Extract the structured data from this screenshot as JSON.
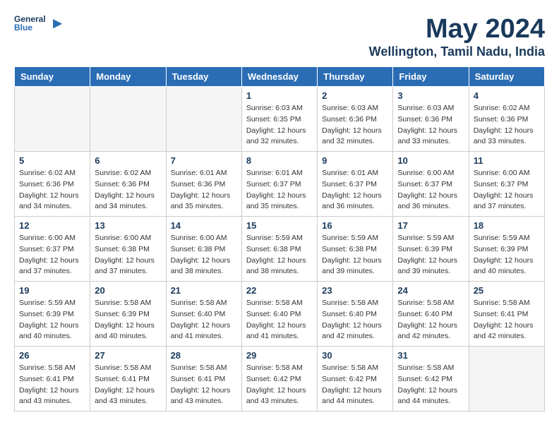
{
  "header": {
    "logo_general": "General",
    "logo_blue": "Blue",
    "main_title": "May 2024",
    "subtitle": "Wellington, Tamil Nadu, India"
  },
  "calendar": {
    "days_of_week": [
      "Sunday",
      "Monday",
      "Tuesday",
      "Wednesday",
      "Thursday",
      "Friday",
      "Saturday"
    ],
    "weeks": [
      [
        {
          "day": "",
          "info": ""
        },
        {
          "day": "",
          "info": ""
        },
        {
          "day": "",
          "info": ""
        },
        {
          "day": "1",
          "info": "Sunrise: 6:03 AM\nSunset: 6:35 PM\nDaylight: 12 hours\nand 32 minutes."
        },
        {
          "day": "2",
          "info": "Sunrise: 6:03 AM\nSunset: 6:36 PM\nDaylight: 12 hours\nand 32 minutes."
        },
        {
          "day": "3",
          "info": "Sunrise: 6:03 AM\nSunset: 6:36 PM\nDaylight: 12 hours\nand 33 minutes."
        },
        {
          "day": "4",
          "info": "Sunrise: 6:02 AM\nSunset: 6:36 PM\nDaylight: 12 hours\nand 33 minutes."
        }
      ],
      [
        {
          "day": "5",
          "info": "Sunrise: 6:02 AM\nSunset: 6:36 PM\nDaylight: 12 hours\nand 34 minutes."
        },
        {
          "day": "6",
          "info": "Sunrise: 6:02 AM\nSunset: 6:36 PM\nDaylight: 12 hours\nand 34 minutes."
        },
        {
          "day": "7",
          "info": "Sunrise: 6:01 AM\nSunset: 6:36 PM\nDaylight: 12 hours\nand 35 minutes."
        },
        {
          "day": "8",
          "info": "Sunrise: 6:01 AM\nSunset: 6:37 PM\nDaylight: 12 hours\nand 35 minutes."
        },
        {
          "day": "9",
          "info": "Sunrise: 6:01 AM\nSunset: 6:37 PM\nDaylight: 12 hours\nand 36 minutes."
        },
        {
          "day": "10",
          "info": "Sunrise: 6:00 AM\nSunset: 6:37 PM\nDaylight: 12 hours\nand 36 minutes."
        },
        {
          "day": "11",
          "info": "Sunrise: 6:00 AM\nSunset: 6:37 PM\nDaylight: 12 hours\nand 37 minutes."
        }
      ],
      [
        {
          "day": "12",
          "info": "Sunrise: 6:00 AM\nSunset: 6:37 PM\nDaylight: 12 hours\nand 37 minutes."
        },
        {
          "day": "13",
          "info": "Sunrise: 6:00 AM\nSunset: 6:38 PM\nDaylight: 12 hours\nand 37 minutes."
        },
        {
          "day": "14",
          "info": "Sunrise: 6:00 AM\nSunset: 6:38 PM\nDaylight: 12 hours\nand 38 minutes."
        },
        {
          "day": "15",
          "info": "Sunrise: 5:59 AM\nSunset: 6:38 PM\nDaylight: 12 hours\nand 38 minutes."
        },
        {
          "day": "16",
          "info": "Sunrise: 5:59 AM\nSunset: 6:38 PM\nDaylight: 12 hours\nand 39 minutes."
        },
        {
          "day": "17",
          "info": "Sunrise: 5:59 AM\nSunset: 6:39 PM\nDaylight: 12 hours\nand 39 minutes."
        },
        {
          "day": "18",
          "info": "Sunrise: 5:59 AM\nSunset: 6:39 PM\nDaylight: 12 hours\nand 40 minutes."
        }
      ],
      [
        {
          "day": "19",
          "info": "Sunrise: 5:59 AM\nSunset: 6:39 PM\nDaylight: 12 hours\nand 40 minutes."
        },
        {
          "day": "20",
          "info": "Sunrise: 5:58 AM\nSunset: 6:39 PM\nDaylight: 12 hours\nand 40 minutes."
        },
        {
          "day": "21",
          "info": "Sunrise: 5:58 AM\nSunset: 6:40 PM\nDaylight: 12 hours\nand 41 minutes."
        },
        {
          "day": "22",
          "info": "Sunrise: 5:58 AM\nSunset: 6:40 PM\nDaylight: 12 hours\nand 41 minutes."
        },
        {
          "day": "23",
          "info": "Sunrise: 5:58 AM\nSunset: 6:40 PM\nDaylight: 12 hours\nand 42 minutes."
        },
        {
          "day": "24",
          "info": "Sunrise: 5:58 AM\nSunset: 6:40 PM\nDaylight: 12 hours\nand 42 minutes."
        },
        {
          "day": "25",
          "info": "Sunrise: 5:58 AM\nSunset: 6:41 PM\nDaylight: 12 hours\nand 42 minutes."
        }
      ],
      [
        {
          "day": "26",
          "info": "Sunrise: 5:58 AM\nSunset: 6:41 PM\nDaylight: 12 hours\nand 43 minutes."
        },
        {
          "day": "27",
          "info": "Sunrise: 5:58 AM\nSunset: 6:41 PM\nDaylight: 12 hours\nand 43 minutes."
        },
        {
          "day": "28",
          "info": "Sunrise: 5:58 AM\nSunset: 6:41 PM\nDaylight: 12 hours\nand 43 minutes."
        },
        {
          "day": "29",
          "info": "Sunrise: 5:58 AM\nSunset: 6:42 PM\nDaylight: 12 hours\nand 43 minutes."
        },
        {
          "day": "30",
          "info": "Sunrise: 5:58 AM\nSunset: 6:42 PM\nDaylight: 12 hours\nand 44 minutes."
        },
        {
          "day": "31",
          "info": "Sunrise: 5:58 AM\nSunset: 6:42 PM\nDaylight: 12 hours\nand 44 minutes."
        },
        {
          "day": "",
          "info": ""
        }
      ]
    ]
  }
}
